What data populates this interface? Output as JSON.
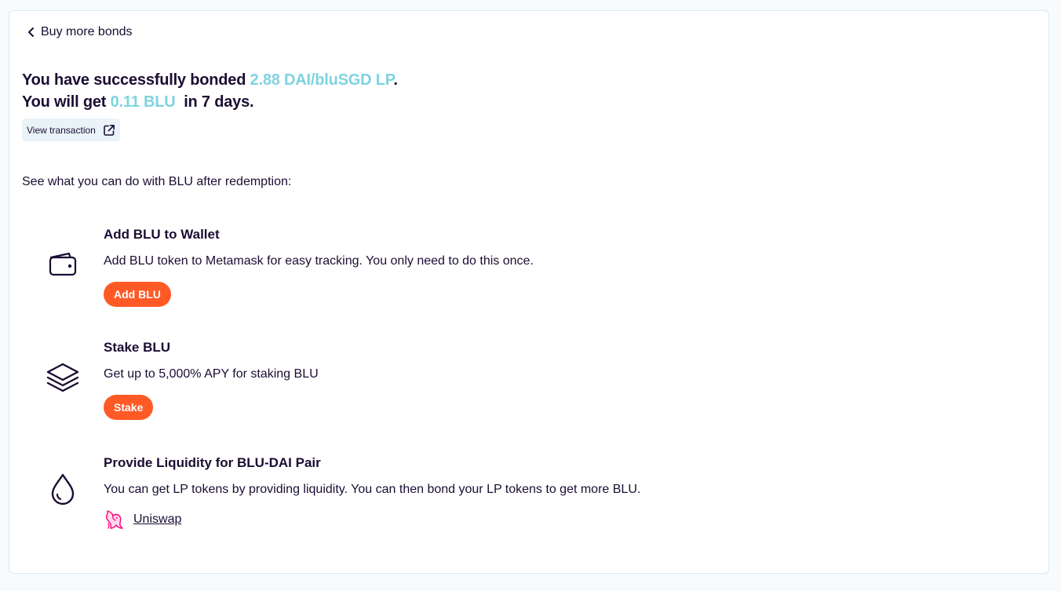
{
  "nav": {
    "back_label": "Buy more bonds"
  },
  "result": {
    "line1_prefix": "You have successfully bonded ",
    "line1_amount": "2.88 DAI/bluSGD LP",
    "line1_suffix": ".",
    "line2_prefix": "You will get ",
    "line2_amount": "0.11 BLU",
    "line2_suffix": "  in 7 days.",
    "view_tx_label": "View transaction"
  },
  "intro_text": "See what you can do with BLU after redemption:",
  "options": [
    {
      "title": "Add BLU to Wallet",
      "description": "Add BLU token to Metamask for easy tracking. You only need to do this once.",
      "button_label": "Add BLU",
      "icon": "wallet-icon"
    },
    {
      "title": "Stake BLU",
      "description": "Get up to 5,000% APY for staking BLU",
      "button_label": "Stake",
      "icon": "layers-icon"
    },
    {
      "title": "Provide Liquidity for BLU-DAI Pair",
      "description": "You can get LP tokens by providing liquidity. You can then bond your LP tokens to get more BLU.",
      "link_label": "Uniswap",
      "icon": "droplet-icon"
    }
  ],
  "colors": {
    "accent": "#7fd3e0",
    "button": "#ff5a26",
    "text": "#1b0d33",
    "uniswap_pink": "#ff007a"
  }
}
